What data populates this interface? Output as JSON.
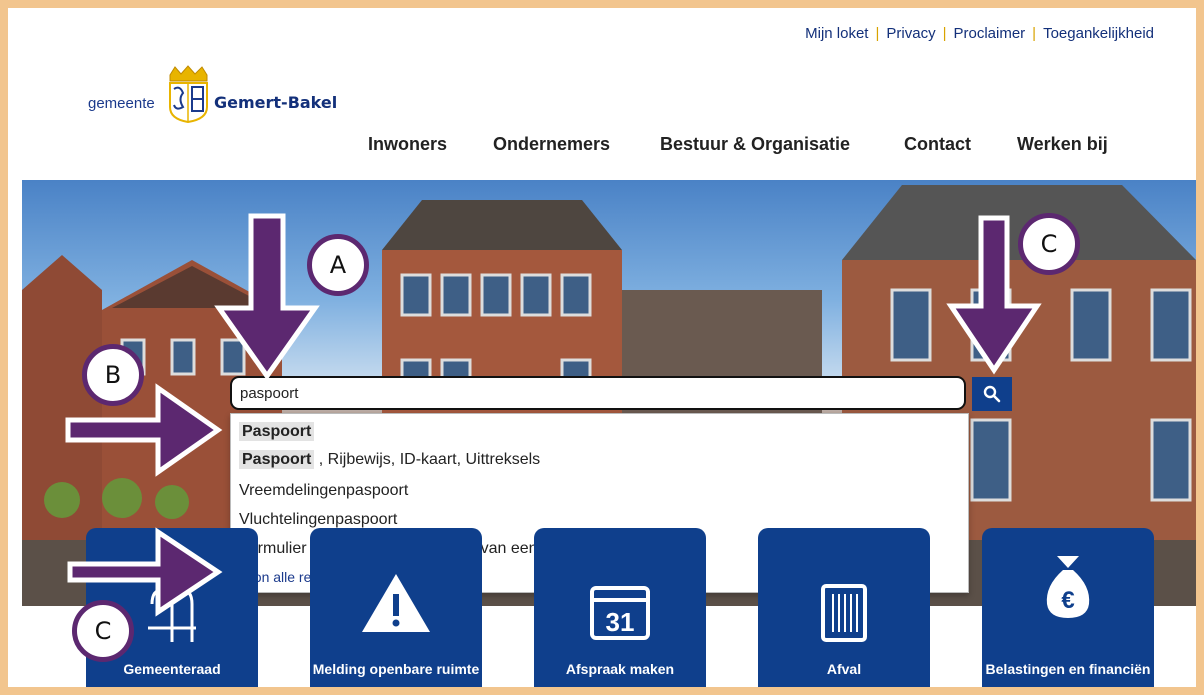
{
  "header": {
    "top_links": [
      "Mijn loket",
      "Privacy",
      "Proclaimer",
      "Toegankelijkheid"
    ],
    "logo_prefix": "gemeente",
    "logo_name": "Gemert-Bakel"
  },
  "nav": [
    "Inwoners",
    "Ondernemers",
    "Bestuur & Organisatie",
    "Contact",
    "Werken bij"
  ],
  "search": {
    "value": "paspoort",
    "suggestions": [
      {
        "highlight": "Paspoort",
        "rest": ""
      },
      {
        "highlight": "Paspoort",
        "rest": " , Rijbewijs, ID-kaart, Uittreksels"
      },
      {
        "highlight": "",
        "rest": "Vreemdelingenpaspoort"
      },
      {
        "highlight": "",
        "rest": "Vluchtelingenpaspoort"
      },
      {
        "highlight": "",
        "rest": "Formulier Toestemming tot afgifte van een reisdocument"
      }
    ],
    "show_all_prefix": "Toon alle resultaten voor \"",
    "show_all_term": "paspoort",
    "show_all_suffix": "\""
  },
  "tiles": [
    {
      "label": "Gemeenteraad",
      "icon": "council-icon"
    },
    {
      "label": "Melding openbare ruimte",
      "icon": "warning-icon"
    },
    {
      "label": "Afspraak maken",
      "icon": "calendar-icon",
      "icon_text": "31"
    },
    {
      "label": "Afval",
      "icon": "waste-bin-icon"
    },
    {
      "label": "Belastingen en financiën",
      "icon": "money-bag-icon",
      "icon_text": "€"
    }
  ],
  "annotations": {
    "a": "A",
    "b": "B",
    "c_top": "C",
    "c_bottom": "C"
  },
  "colors": {
    "brand_blue": "#0f3f8c",
    "annotation_purple": "#5c2870",
    "frame": "#f2c58e",
    "separator": "#d9a300"
  }
}
